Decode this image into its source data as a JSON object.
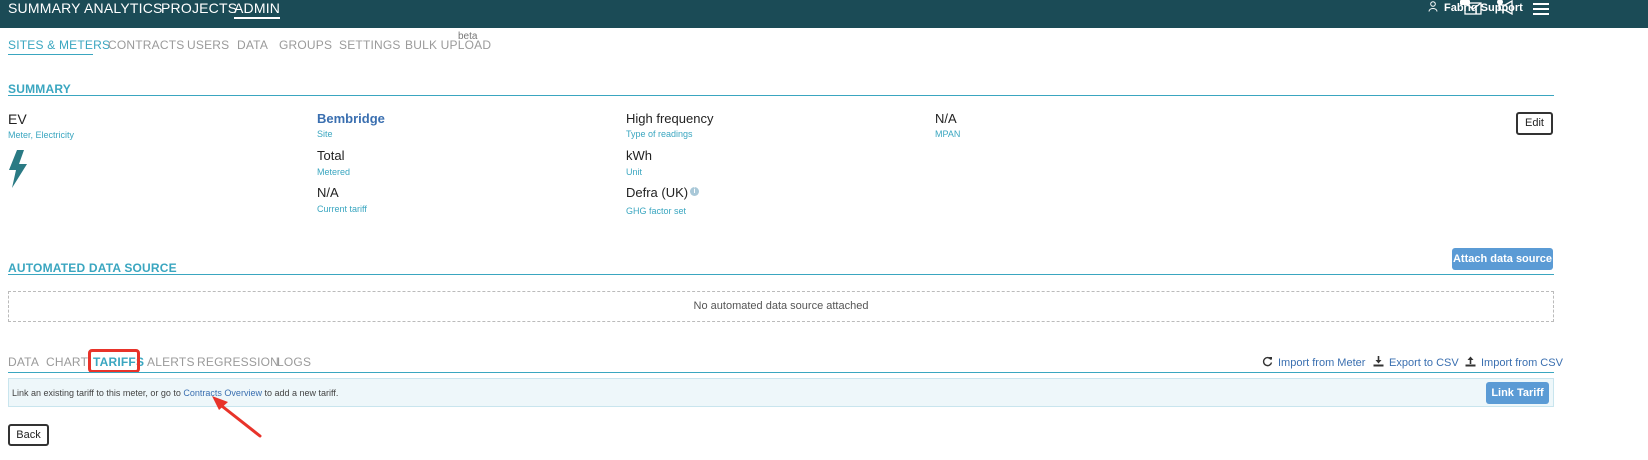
{
  "topnav": {
    "items": [
      {
        "label": "SUMMARY",
        "active": false
      },
      {
        "label": "ANALYTICS",
        "active": false
      },
      {
        "label": "PROJECTS",
        "active": false
      },
      {
        "label": "ADMIN",
        "active": true
      }
    ],
    "user_name": "Fabriq Support",
    "icons": [
      "user-icon",
      "mail-icon",
      "megaphone-icon",
      "menu-icon"
    ]
  },
  "subnav": {
    "items": [
      {
        "label": "SITES & METERS",
        "active": true
      },
      {
        "label": "CONTRACTS",
        "active": false
      },
      {
        "label": "USERS",
        "active": false
      },
      {
        "label": "DATA",
        "active": false
      },
      {
        "label": "GROUPS",
        "active": false
      },
      {
        "label": "SETTINGS",
        "active": false
      },
      {
        "label": "BULK UPLOAD",
        "active": false
      }
    ],
    "beta_label": "beta"
  },
  "summary": {
    "title": "SUMMARY",
    "meter_name": "EV",
    "meter_type": "Meter, Electricity",
    "site_value": "Bembridge",
    "site_label": "Site",
    "metered_value": "Total",
    "metered_label": "Metered",
    "tariff_value": "N/A",
    "tariff_label": "Current tariff",
    "readings_value": "High frequency",
    "readings_label": "Type of readings",
    "unit_value": "kWh",
    "unit_label": "Unit",
    "ghg_value": "Defra (UK)",
    "ghg_label": "GHG factor set",
    "mpan_value": "N/A",
    "mpan_label": "MPAN",
    "edit_label": "Edit"
  },
  "automated": {
    "title": "AUTOMATED DATA SOURCE",
    "attach_label": "Attach data source",
    "empty_text": "No automated data source attached"
  },
  "tabs": {
    "items": [
      {
        "label": "DATA",
        "active": false
      },
      {
        "label": "CHART",
        "active": false
      },
      {
        "label": "TARIFFS",
        "active": true
      },
      {
        "label": "ALERTS",
        "active": false
      },
      {
        "label": "REGRESSION",
        "active": false
      },
      {
        "label": "LOGS",
        "active": false
      }
    ],
    "actions": [
      {
        "label": "Import from Meter",
        "icon": "refresh-icon"
      },
      {
        "label": "Export to CSV",
        "icon": "download-icon"
      },
      {
        "label": "Import from CSV",
        "icon": "upload-icon"
      }
    ]
  },
  "tariffs": {
    "info_before": "Link an existing tariff to this meter, or go to ",
    "info_link": "Contracts Overview",
    "info_after": " to add a new tariff.",
    "link_button": "Link Tariff"
  },
  "footer": {
    "back_label": "Back"
  },
  "colors": {
    "topbar": "#1b4b56",
    "accent": "#3aa6c0",
    "button_blue": "#5b9bd5",
    "annotation_red": "#e8332a"
  }
}
